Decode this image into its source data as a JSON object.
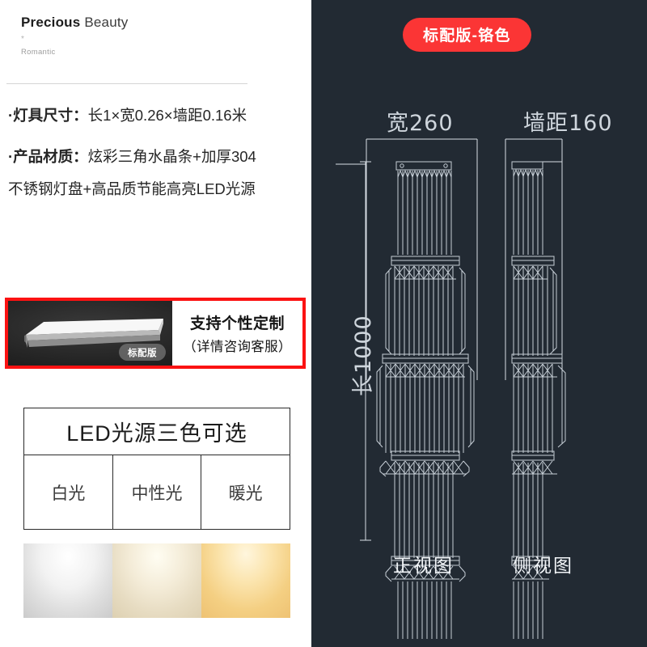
{
  "brand": {
    "name_bold": "Precious",
    "name_light": "Beauty",
    "star": "*",
    "tagline": "Romantic"
  },
  "specs": [
    {
      "key": "·灯具尺寸：",
      "value": "长1×宽0.26×墙距0.16米"
    },
    {
      "key": "·产品材质：",
      "value": "炫彩三角水晶条+加厚304"
    },
    {
      "key": "",
      "value": "不锈钢灯盘+高品质节能高亮LED光源"
    }
  ],
  "custom_box": {
    "photo_badge": "标配版",
    "title": "支持个性定制",
    "subtitle": "（详情咨询客服）",
    "border_color": "#fb1212"
  },
  "led_table": {
    "header": "LED光源三色可选",
    "columns": [
      {
        "label": "白光",
        "swatch": "#f0f0f0"
      },
      {
        "label": "中性光",
        "swatch": "#eee3c9"
      },
      {
        "label": "暖光",
        "swatch": "#f6cf85"
      }
    ]
  },
  "right_panel": {
    "background": "#222a33",
    "badge": "标配版-铬色",
    "badge_color": "#fb3535",
    "dimensions": {
      "width_label": "宽260",
      "depth_label": "墙距160",
      "height_label": "长1000"
    },
    "views": [
      {
        "label": "正视图"
      },
      {
        "label": "侧视图"
      }
    ]
  }
}
